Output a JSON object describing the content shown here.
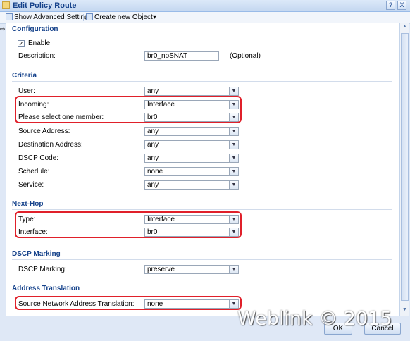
{
  "window": {
    "title": "Edit Policy Route",
    "help_label": "?",
    "close_label": "X"
  },
  "toolbar": {
    "advanced_label": "Show Advanced Settings",
    "create_label": "Create new Object▾"
  },
  "sections": {
    "configuration": "Configuration",
    "criteria": "Criteria",
    "nexthop": "Next-Hop",
    "dscp": "DSCP Marking",
    "address": "Address Translation"
  },
  "configuration": {
    "enable_label": "Enable",
    "enable_checked": true,
    "description_label": "Description:",
    "description_value": "br0_noSNAT",
    "optional_hint": "(Optional)"
  },
  "criteria": {
    "user_label": "User:",
    "user_value": "any",
    "incoming_label": "Incoming:",
    "incoming_value": "Interface",
    "member_label": "Please select one member:",
    "member_value": "br0",
    "source_label": "Source Address:",
    "source_value": "any",
    "destination_label": "Destination Address:",
    "destination_value": "any",
    "dscp_label": "DSCP Code:",
    "dscp_value": "any",
    "schedule_label": "Schedule:",
    "schedule_value": "none",
    "service_label": "Service:",
    "service_value": "any"
  },
  "nexthop": {
    "type_label": "Type:",
    "type_value": "Interface",
    "interface_label": "Interface:",
    "interface_value": "br0"
  },
  "dscp_marking": {
    "label": "DSCP Marking:",
    "value": "preserve"
  },
  "address_translation": {
    "snat_label": "Source Network Address Translation:",
    "snat_value": "none"
  },
  "footer": {
    "ok_label": "OK",
    "cancel_label": "Cancel"
  },
  "watermark": "Weblink © 2015",
  "colors": {
    "highlight": "#e0202a",
    "section_title": "#15428b"
  }
}
